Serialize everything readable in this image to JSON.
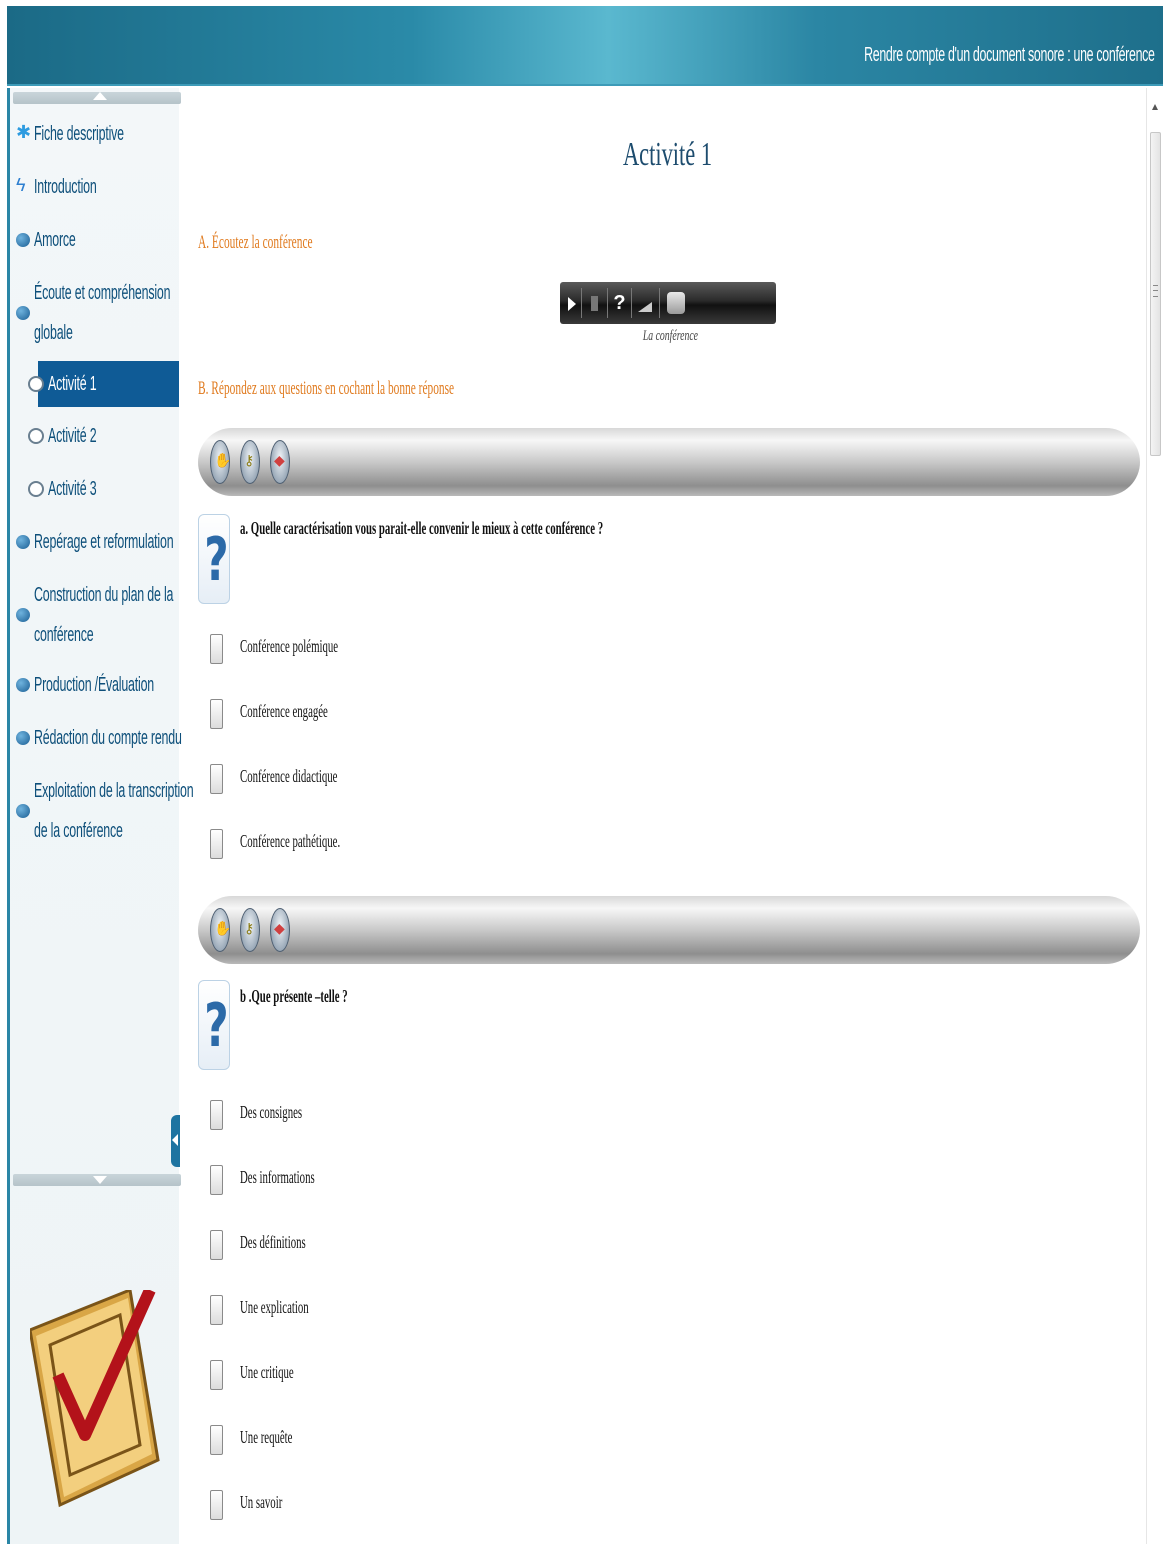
{
  "header": {
    "title": "Rendre compte d'un document sonore : une conférence"
  },
  "sidebar": {
    "items": [
      {
        "label": "Fiche descriptive",
        "icon": "star-icon"
      },
      {
        "label": "Introduction",
        "icon": "bolt-icon"
      },
      {
        "label": "Amorce",
        "icon": "chevron-right-circle-icon"
      },
      {
        "label_line1": "Écoute et compréhension",
        "label_line2": "globale",
        "icon": "chevron-down-circle-icon"
      },
      {
        "label": "Activité 1",
        "icon": "activity-icon",
        "active": true
      },
      {
        "label": "Activité 2",
        "icon": "activity-icon"
      },
      {
        "label": "Activité 3",
        "icon": "activity-icon"
      },
      {
        "label": "Repérage et reformulation",
        "icon": "chevron-right-circle-icon"
      },
      {
        "label_line1": "Construction du plan de la",
        "label_line2": "conférence",
        "icon": "chevron-right-circle-icon"
      },
      {
        "label": "Production /Évaluation",
        "icon": "chevron-right-circle-icon"
      },
      {
        "label": "Rédaction du compte rendu",
        "icon": "chevron-right-circle-icon"
      },
      {
        "label_line1": "Exploitation de la transcription",
        "label_line2": "de la conférence",
        "icon": "chevron-right-circle-icon"
      }
    ]
  },
  "main": {
    "title": "Activité 1",
    "section_a": "A. Écoutez la conférence",
    "player": {
      "help": "?",
      "caption": "La conférence"
    },
    "section_b": "B. Répondez aux questions en cochant la bonne réponse",
    "questions": [
      {
        "text": "a. Quelle caractérisation vous parait-elle convenir le mieux à cette conférence ?",
        "options": [
          "Conférence polémique",
          "Conférence engagée",
          "Conférence didactique",
          "Conférence pathétique."
        ]
      },
      {
        "text": "b .Que présente –telle ?",
        "options": [
          "Des consignes",
          "Des informations",
          "Des définitions",
          "Une explication",
          "Une critique",
          "Une requête",
          "Un savoir"
        ]
      }
    ],
    "question_icon": "?"
  },
  "colors": {
    "header": "#2a8aa8",
    "nav_text": "#0d4f7a",
    "active_bg": "#0f5b96",
    "section_title": "#e07a1e",
    "page_title": "#1d4c6e"
  }
}
